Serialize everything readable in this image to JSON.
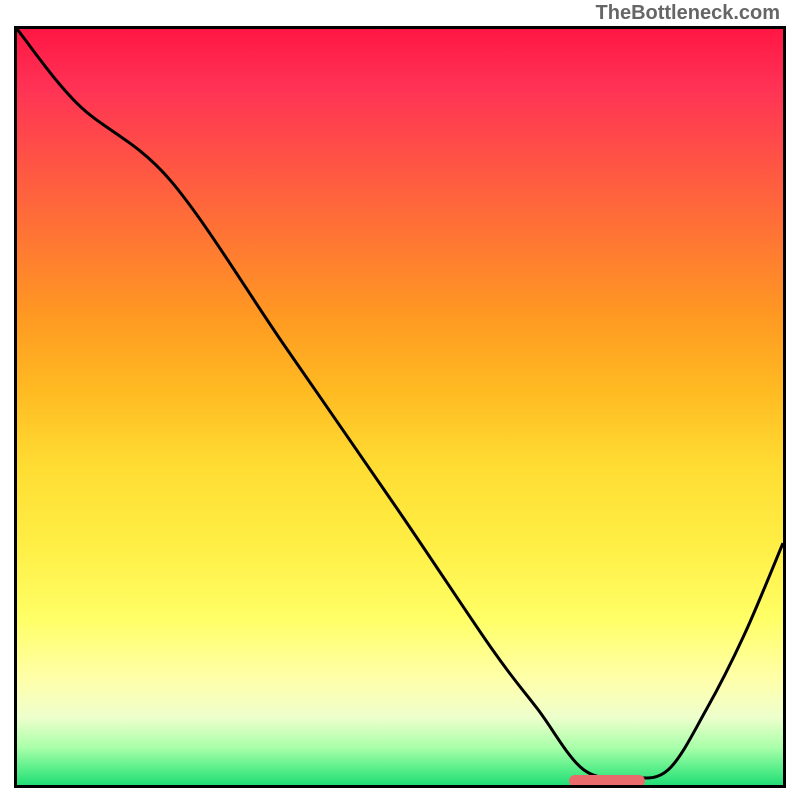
{
  "watermark": "TheBottleneck.com",
  "chart_data": {
    "type": "line",
    "title": "",
    "xlabel": "",
    "ylabel": "",
    "xlim": [
      0,
      100
    ],
    "ylim": [
      0,
      100
    ],
    "series": [
      {
        "name": "bottleneck-curve",
        "x": [
          0,
          8,
          20,
          35,
          50,
          62,
          68,
          74,
          80,
          85,
          90,
          95,
          100
        ],
        "values": [
          100,
          90,
          80,
          58,
          36,
          18,
          10,
          2,
          1,
          2,
          10,
          20,
          32
        ]
      }
    ],
    "annotations": [
      {
        "name": "optimal-marker",
        "type": "bar",
        "x_start": 72,
        "x_end": 82,
        "y": 0.5,
        "color": "#e96b6b"
      }
    ],
    "background": {
      "type": "vertical-gradient",
      "stops": [
        {
          "pos": 0,
          "color": "#ff1744"
        },
        {
          "pos": 50,
          "color": "#ffcc33"
        },
        {
          "pos": 85,
          "color": "#ffff99"
        },
        {
          "pos": 100,
          "color": "#22dd77"
        }
      ]
    }
  },
  "layout": {
    "chart_inner_width": 766,
    "chart_inner_height": 756
  }
}
